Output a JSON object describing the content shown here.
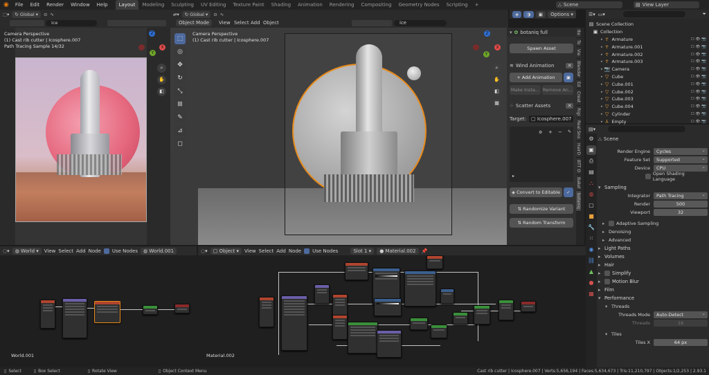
{
  "menu": [
    "File",
    "Edit",
    "Render",
    "Window",
    "Help"
  ],
  "workspaces": [
    "Layout",
    "Modeling",
    "Sculpting",
    "UV Editing",
    "Texture Paint",
    "Shading",
    "Animation",
    "Rendering",
    "Compositing",
    "Geometry Nodes",
    "Scripting"
  ],
  "scene": {
    "name": "Scene",
    "view_layer": "View Layer"
  },
  "left_viewport": {
    "orientation": "Global",
    "search": "ice",
    "overlay": [
      "Camera Perspective",
      "(1) Cast rib cutter | Icosphere.007",
      "Path Tracing Sample 14/32"
    ]
  },
  "main_viewport": {
    "orientation": "Global",
    "search": "ice",
    "mode": "Object Mode",
    "menus": [
      "View",
      "Select",
      "Add",
      "Object"
    ],
    "overlay": [
      "Camera Perspective",
      "(1) Cast rib cutter | Icosphere.007"
    ],
    "options_label": "Options"
  },
  "gizmo": {
    "x": "X",
    "y": "Y",
    "z": "Z"
  },
  "botaniq": {
    "title": "botaniq full",
    "spawn_asset": "Spawn Asset",
    "wind_animation": "Wind Animation",
    "add_animation": "Add Animation",
    "make_instance": "Make Insta...",
    "remove_animation": "Remove An...",
    "scatter_assets": "Scatter Assets",
    "target_label": "Target:",
    "target_value": "Icosphere.007",
    "convert_to_editable": "Convert to Editable",
    "randomize_variant": "Randomize Variant",
    "random_transform": "Random Transform",
    "side_tabs": [
      "Ite",
      "To",
      "Vie",
      "Blender",
      "Ed",
      "Creat",
      "Rigi",
      "Real Sno",
      "HairD",
      "BTT O",
      "Bakel",
      "botaniq"
    ]
  },
  "outliner": {
    "title": "Scene Collection",
    "items": [
      {
        "label": "Collection",
        "depth": 0,
        "icon": "collection-icon"
      },
      {
        "label": "Armature",
        "depth": 1,
        "icon": "armature-icon"
      },
      {
        "label": "Armature.001",
        "depth": 1,
        "icon": "armature-icon"
      },
      {
        "label": "Armature.002",
        "depth": 1,
        "icon": "armature-icon"
      },
      {
        "label": "Armature.003",
        "depth": 1,
        "icon": "armature-icon"
      },
      {
        "label": "Camera",
        "depth": 1,
        "icon": "camera-icon"
      },
      {
        "label": "Cube",
        "depth": 1,
        "icon": "mesh-icon"
      },
      {
        "label": "Cube.001",
        "depth": 1,
        "icon": "mesh-icon"
      },
      {
        "label": "Cube.002",
        "depth": 1,
        "icon": "mesh-icon"
      },
      {
        "label": "Cube.003",
        "depth": 1,
        "icon": "mesh-icon"
      },
      {
        "label": "Cube.004",
        "depth": 1,
        "icon": "mesh-icon"
      },
      {
        "label": "Cylinder",
        "depth": 1,
        "icon": "mesh-icon"
      },
      {
        "label": "Empty",
        "depth": 1,
        "icon": "empty-icon"
      }
    ]
  },
  "properties": {
    "scene_label": "Scene",
    "render_engine": {
      "label": "Render Engine",
      "value": "Cycles"
    },
    "feature_set": {
      "label": "Feature Set",
      "value": "Supported"
    },
    "device": {
      "label": "Device",
      "value": "CPU"
    },
    "open_shading_language": "Open Shading Language",
    "sampling": "Sampling",
    "integrator": {
      "label": "Integrator",
      "value": "Path Tracing"
    },
    "render_samples": {
      "label": "Render",
      "value": "500"
    },
    "viewport_samples": {
      "label": "Viewport",
      "value": "32"
    },
    "adaptive_sampling": "Adaptive Sampling",
    "denoising": "Denoising",
    "advanced": "Advanced",
    "light_paths": "Light Paths",
    "volumes": "Volumes",
    "hair": "Hair",
    "simplify": "Simplify",
    "motion_blur": "Motion Blur",
    "film": "Film",
    "performance": "Performance",
    "threads": "Threads",
    "threads_mode": {
      "label": "Threads Mode",
      "value": "Auto-Detect"
    },
    "threads_count": {
      "label": "Threads",
      "value": "16"
    },
    "tiles": "Tiles",
    "tiles_x": {
      "label": "Tiles X",
      "value": "64 px"
    }
  },
  "node_editor_left": {
    "type": "World",
    "menus": [
      "View",
      "Select",
      "Add",
      "Node"
    ],
    "use_nodes": "Use Nodes",
    "datablock": "World.001",
    "label": "World.001"
  },
  "node_editor_right": {
    "type": "Object",
    "menus": [
      "View",
      "Select",
      "Add",
      "Node"
    ],
    "use_nodes": "Use Nodes",
    "slot": "Slot 1",
    "datablock": "Material.002",
    "label": "Material.002"
  },
  "statusbar": {
    "select": "Select",
    "box_select": "Box Select",
    "rotate_view": "Rotate View",
    "context_menu": "Object Context Menu",
    "stats": "Cast rib cutter | Icosphere.007 | Verts:5,656,194 | Faces:5,634,673 | Tris:11,210,797 | Objects:1/2,253 | 2.93.1"
  }
}
